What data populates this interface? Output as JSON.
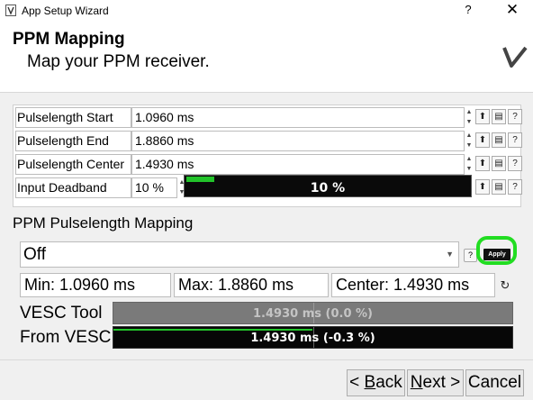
{
  "window": {
    "title": "App Setup Wizard",
    "help_label": "?",
    "close_label": "✕"
  },
  "header": {
    "title": "PPM Mapping",
    "subtitle": "Map your PPM receiver."
  },
  "params": [
    {
      "label": "Pulselength Start",
      "value": "1.0960 ms"
    },
    {
      "label": "Pulselength End",
      "value": "1.8860 ms"
    },
    {
      "label": "Pulselength Center",
      "value": "1.4930 ms"
    },
    {
      "label": "Input Deadband",
      "value": "10 %"
    }
  ],
  "deadband_bar": {
    "text": "10 %",
    "fraction": 0.1,
    "fill_color": "#22c32a"
  },
  "mapping": {
    "section_title": "PPM Pulselength Mapping",
    "mode_value": "Off",
    "apply_label": "Apply",
    "min_text": "Min: 1.0960 ms",
    "max_text": "Max: 1.8860 ms",
    "center_text": "Center: 1.4930 ms",
    "vesc_tool_label": "VESC Tool",
    "vesc_tool_value": "1.4930 ms (0.0 %)",
    "from_vesc_label": "From VESC",
    "from_vesc_value": "1.4930 ms (-0.3 %)"
  },
  "footer": {
    "back_prefix": "< ",
    "back_key": "B",
    "back_rest": "ack",
    "next_key": "N",
    "next_rest": "ext >",
    "cancel_label": "Cancel"
  },
  "icons": {
    "row_buttons": [
      "upload-icon",
      "paste-icon",
      "help-icon"
    ],
    "highlight_color": "#22dd22"
  }
}
